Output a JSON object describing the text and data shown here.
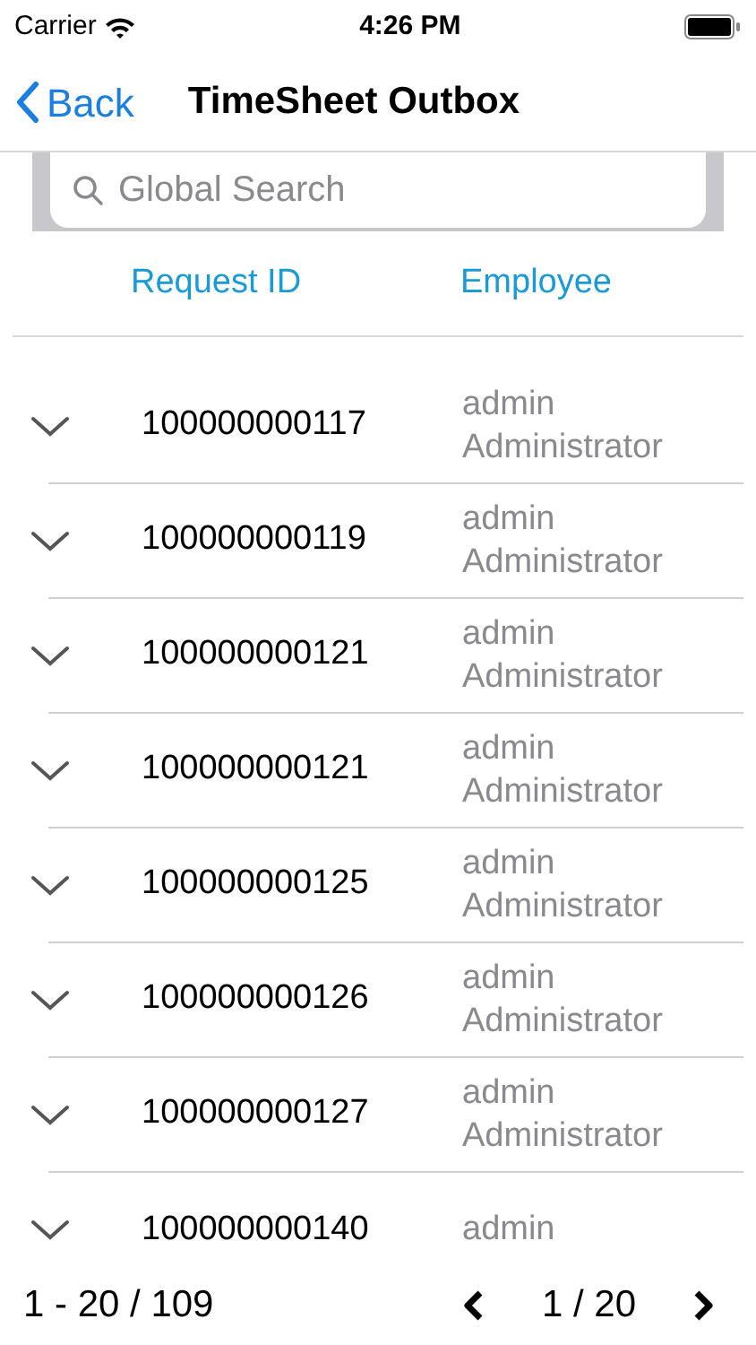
{
  "status_bar": {
    "carrier": "Carrier",
    "time": "4:26 PM"
  },
  "nav": {
    "back": "Back",
    "title": "TimeSheet Outbox"
  },
  "search": {
    "placeholder": "Global Search"
  },
  "table": {
    "columns": [
      "Request ID",
      "Employee"
    ],
    "rows": [
      {
        "id": "100000000117",
        "user": "admin",
        "name": "Administrator"
      },
      {
        "id": "100000000119",
        "user": "admin",
        "name": "Administrator"
      },
      {
        "id": "100000000121",
        "user": "admin",
        "name": "Administrator"
      },
      {
        "id": "100000000121",
        "user": "admin",
        "name": "Administrator"
      },
      {
        "id": "100000000125",
        "user": "admin",
        "name": "Administrator"
      },
      {
        "id": "100000000126",
        "user": "admin",
        "name": "Administrator"
      },
      {
        "id": "100000000127",
        "user": "admin",
        "name": "Administrator"
      },
      {
        "id": "100000000140",
        "user": "admin"
      }
    ]
  },
  "pagination": {
    "range": "1 - 20 / 109",
    "page": "1 / 20"
  }
}
